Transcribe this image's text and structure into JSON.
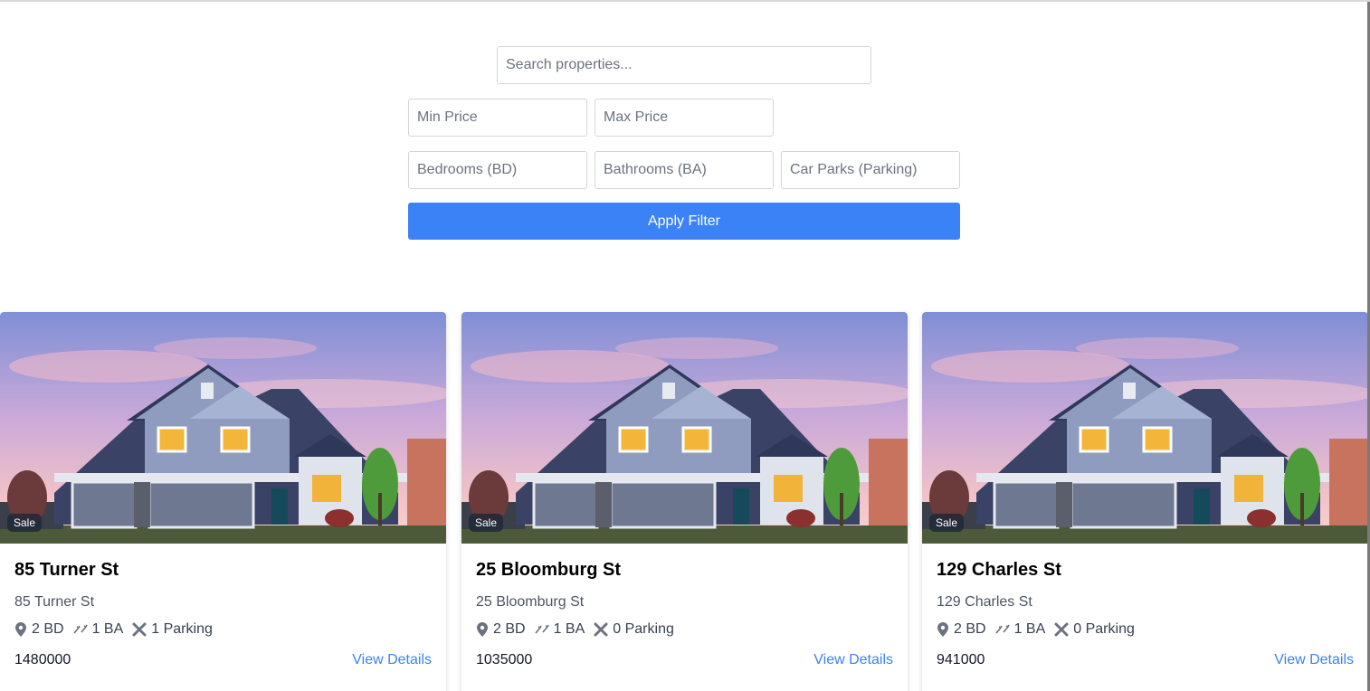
{
  "filters": {
    "search_placeholder": "Search properties...",
    "min_price_placeholder": "Min Price",
    "max_price_placeholder": "Max Price",
    "bedrooms_placeholder": "Bedrooms (BD)",
    "bathrooms_placeholder": "Bathrooms (BA)",
    "parking_placeholder": "Car Parks (Parking)",
    "apply_label": "Apply Filter"
  },
  "listings": [
    {
      "badge": "Sale",
      "title": "85 Turner St",
      "address": "85 Turner St",
      "bedrooms": "2 BD",
      "bathrooms": "1 BA",
      "parking": "1 Parking",
      "price": "1480000",
      "link_label": "View Details"
    },
    {
      "badge": "Sale",
      "title": "25 Bloomburg St",
      "address": "25 Bloomburg St",
      "bedrooms": "2 BD",
      "bathrooms": "1 BA",
      "parking": "0 Parking",
      "price": "1035000",
      "link_label": "View Details"
    },
    {
      "badge": "Sale",
      "title": "129 Charles St",
      "address": "129 Charles St",
      "bedrooms": "2 BD",
      "bathrooms": "1 BA",
      "parking": "0 Parking",
      "price": "941000",
      "link_label": "View Details"
    }
  ],
  "icons": {
    "bedrooms": "map-pin-icon",
    "bathrooms": "shower-icon",
    "parking": "tools-icon"
  },
  "colors": {
    "accent": "#3b82f6",
    "badge_bg": "#1f2937"
  }
}
